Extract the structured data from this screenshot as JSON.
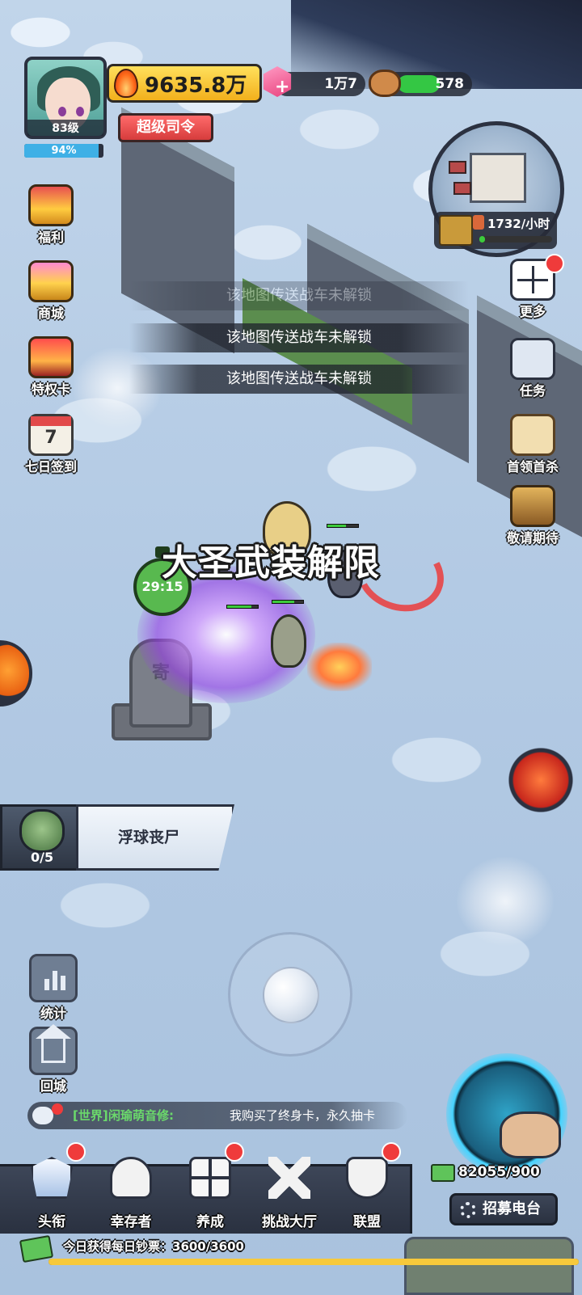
{
  "hud": {
    "level": "83级",
    "exp_percent": "94%",
    "exp_fraction": 0.94,
    "power": "9635.8万",
    "title": "超级司令",
    "gems": "1万7",
    "wood": "578",
    "wood_fraction": 0.55
  },
  "minimap": {
    "income": "1732/小时",
    "income_fill": 0.08
  },
  "left_menu": [
    {
      "label": "福利",
      "icon": "gift-balloons-icon"
    },
    {
      "label": "商城",
      "icon": "shop-basket-icon"
    },
    {
      "label": "特权卡",
      "icon": "vip-card-icon"
    },
    {
      "label": "七日签到",
      "icon": "calendar-icon",
      "day": "7"
    }
  ],
  "right_menu": [
    {
      "label": "更多",
      "icon": "grid-more-icon",
      "badge": true
    },
    {
      "label": "任务",
      "icon": "task-notebook-icon"
    },
    {
      "label": "首领首杀",
      "icon": "wanted-poster-icon"
    },
    {
      "label": "敬请期待",
      "icon": "coming-soon-icon"
    }
  ],
  "toasts": [
    "该地图传送战车未解锁",
    "该地图传送战车未解锁",
    "该地图传送战车未解锁"
  ],
  "battle": {
    "timer": "29:15",
    "skill_banner": "大圣武装解限",
    "wave_count": "0/5",
    "enemy_name": "浮球丧尸",
    "gravestone_text": "寄"
  },
  "tools": [
    {
      "label": "统计",
      "icon": "stats-bars-icon"
    },
    {
      "label": "回城",
      "icon": "home-return-icon"
    }
  ],
  "chat": {
    "channel": "[世界]",
    "user": "闲瑜萌音修:",
    "message": "我购买了终身卡，永久抽卡"
  },
  "nav": [
    {
      "label": "头衔",
      "icon": "rank-badge-icon",
      "badge": true
    },
    {
      "label": "幸存者",
      "icon": "cowboy-hat-icon",
      "badge": false
    },
    {
      "label": "养成",
      "icon": "grid-upgrade-icon",
      "badge": true
    },
    {
      "label": "挑战大厅",
      "icon": "crossed-guns-icon",
      "badge": false
    },
    {
      "label": "联盟",
      "icon": "alliance-shield-icon",
      "badge": true
    }
  ],
  "recruit": {
    "count": "82055/900",
    "button": "招募电台"
  },
  "daily": {
    "text": "今日获得每日钞票：3600/3600",
    "fraction": 1.0
  }
}
